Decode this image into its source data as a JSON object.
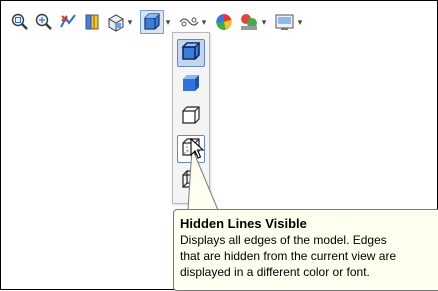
{
  "toolbar": {
    "items": [
      {
        "icon": "zoom-to-fit-icon"
      },
      {
        "icon": "zoom-to-area-icon"
      },
      {
        "icon": "previous-view-icon"
      },
      {
        "icon": "section-view-icon"
      },
      {
        "icon": "view-orientation-icon",
        "has_dropdown": true
      },
      {
        "icon": "display-style-icon",
        "has_dropdown": true,
        "pressed": true
      },
      {
        "icon": "hide-show-items-icon",
        "has_dropdown": true
      },
      {
        "icon": "edit-appearance-icon"
      },
      {
        "icon": "apply-scene-icon",
        "has_dropdown": true
      },
      {
        "icon": "view-settings-icon",
        "has_dropdown": true
      }
    ]
  },
  "display_style_menu": {
    "items": [
      {
        "icon": "shaded-with-edges-icon",
        "state": "selected"
      },
      {
        "icon": "shaded-icon",
        "state": "normal"
      },
      {
        "icon": "hidden-lines-removed-icon",
        "state": "normal"
      },
      {
        "icon": "hidden-lines-visible-icon",
        "state": "hover"
      },
      {
        "icon": "wireframe-icon",
        "state": "normal"
      }
    ]
  },
  "tooltip": {
    "title": "Hidden Lines Visible",
    "lines": [
      "Displays all edges of the model. Edges",
      "that are hidden from the current view are",
      "displayed in a different color or font."
    ]
  },
  "colors": {
    "accent_blue": "#3d7fd8",
    "tooltip_bg": "#fffff0",
    "menu_selected": "#c6d5ee"
  }
}
